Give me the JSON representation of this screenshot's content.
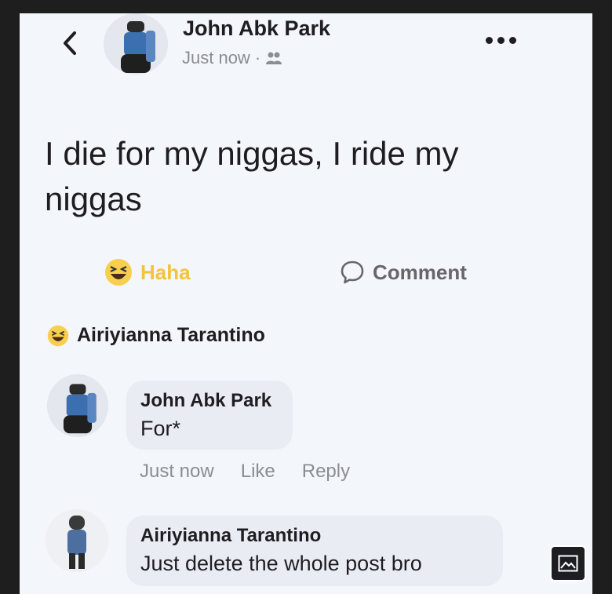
{
  "post": {
    "author": "John Abk Park",
    "time": "Just now",
    "separator": "·",
    "audience_icon": "friends-icon",
    "text": "I die for my niggas, I ride my niggas"
  },
  "actions": {
    "reaction_label": "Haha",
    "comment_label": "Comment"
  },
  "reactor": {
    "name": "Airiyianna Tarantino",
    "reaction": "haha"
  },
  "comments": [
    {
      "author": "John Abk Park",
      "text": "For*",
      "time": "Just now",
      "like": "Like",
      "reply": "Reply"
    },
    {
      "author": "Airiyianna Tarantino",
      "text": "Just delete the whole post bro"
    }
  ],
  "colors": {
    "background": "#f3f6fa",
    "haha": "#f5c33b",
    "muted": "#8a8d91"
  }
}
